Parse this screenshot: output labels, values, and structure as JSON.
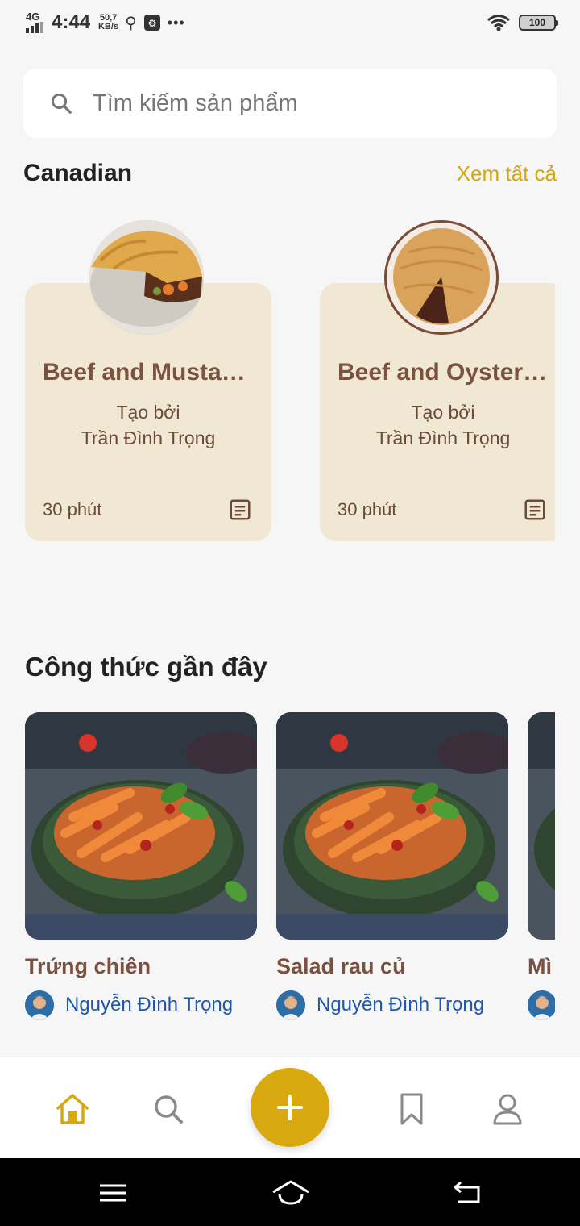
{
  "status_bar": {
    "network": "4G",
    "time": "4:44",
    "speed_value": "50,7",
    "speed_unit": "KB/s",
    "battery": "100"
  },
  "search": {
    "placeholder": "Tìm kiếm sản phẩm"
  },
  "category": {
    "title": "Canadian",
    "see_all": "Xem tất cả",
    "recipes": [
      {
        "title": "Beef and Mustard Pie",
        "created_label": "Tạo bởi",
        "author": "Trần Đình Trọng",
        "time": "30 phút"
      },
      {
        "title": "Beef and Oyster Pie",
        "created_label": "Tạo bởi",
        "author": "Trần Đình Trọng",
        "time": "30 phút"
      }
    ]
  },
  "recent": {
    "title": "Công thức gần đây",
    "items": [
      {
        "name": "Trứng chiên",
        "author": "Nguyễn Đình Trọng"
      },
      {
        "name": "Salad rau củ",
        "author": "Nguyễn Đình Trọng"
      },
      {
        "name": "Mì",
        "author": ""
      }
    ]
  },
  "colors": {
    "accent": "#d8a90f",
    "card_bg": "#f0e8d3",
    "title_brown": "#7b5140",
    "author_blue": "#1f57a8"
  },
  "bottom_nav": {
    "items": [
      "home-icon",
      "search-icon",
      "add-icon",
      "bookmark-icon",
      "profile-icon"
    ],
    "active": "home-icon"
  }
}
